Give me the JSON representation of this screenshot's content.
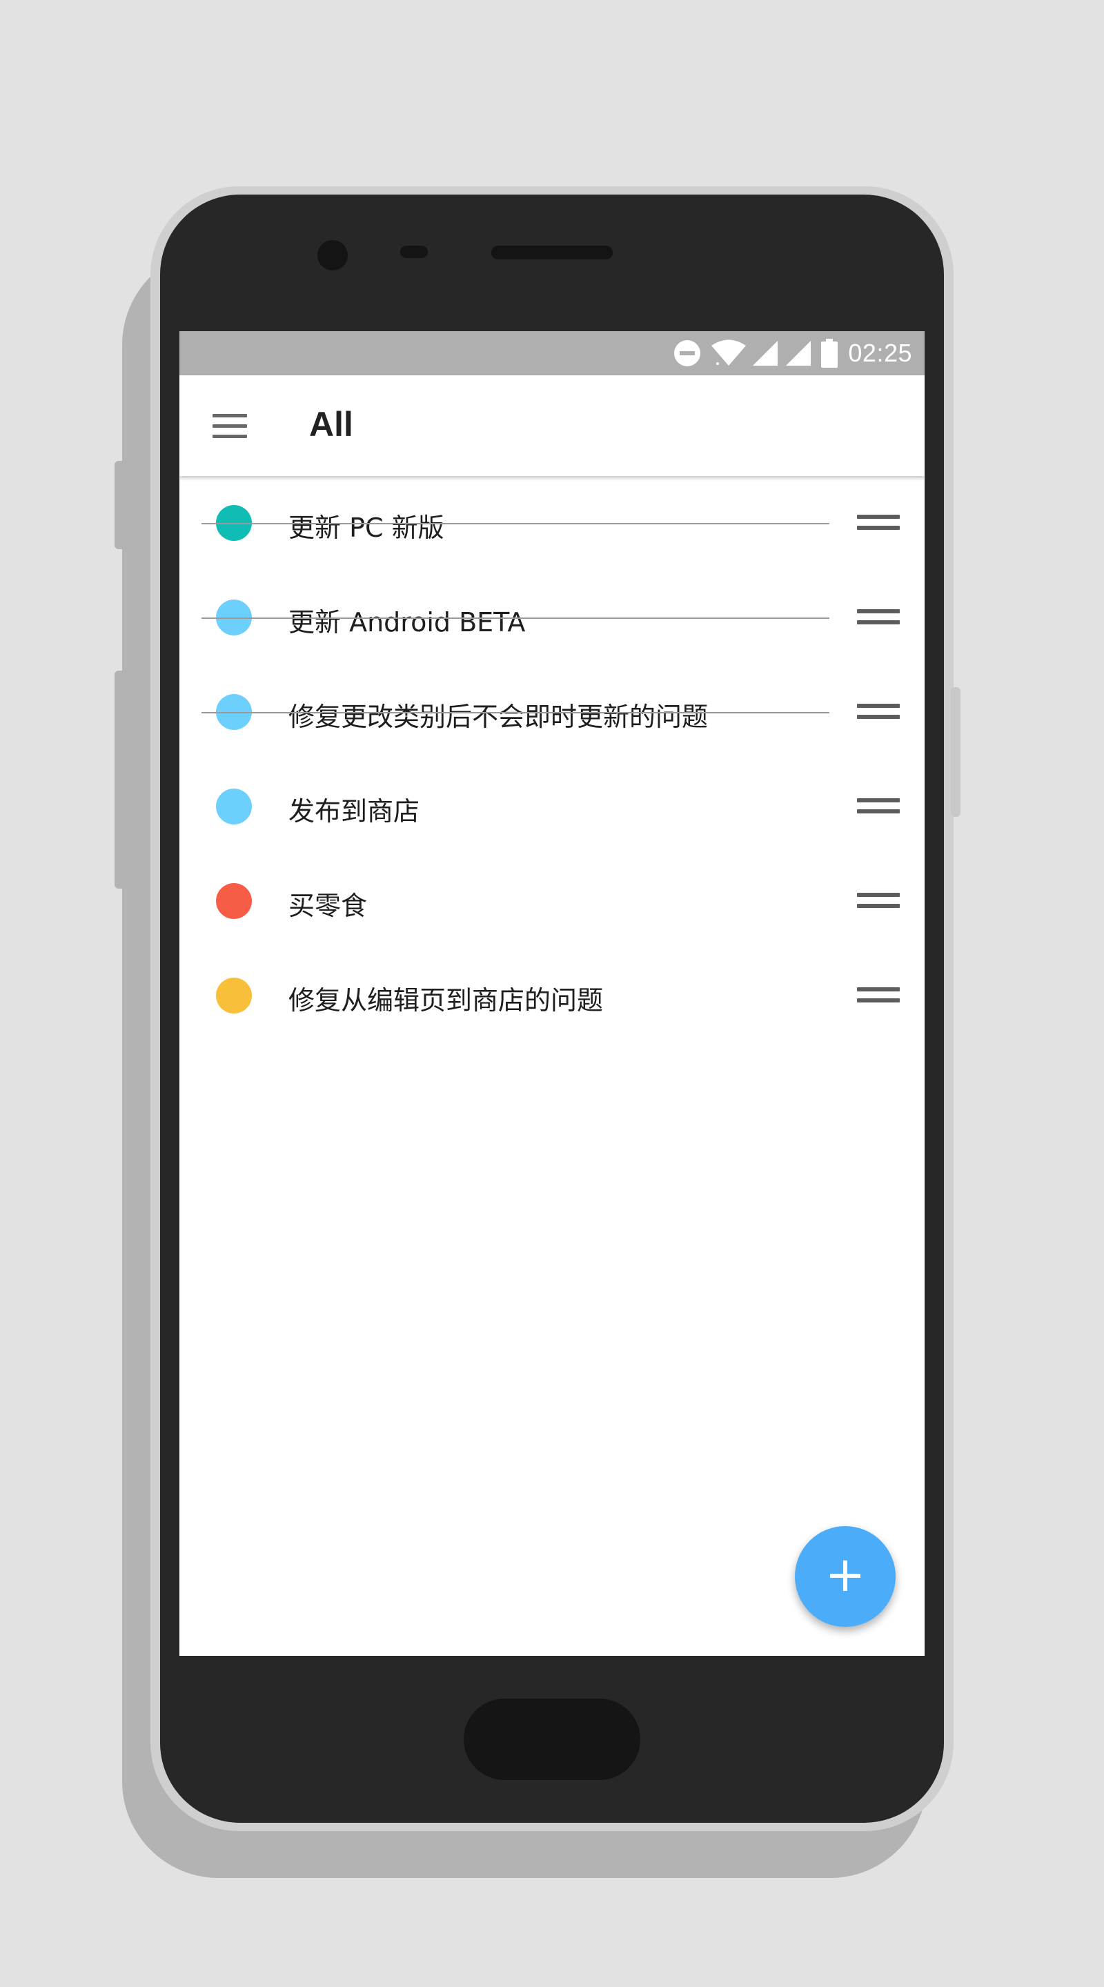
{
  "status_bar": {
    "time": "02:25",
    "icons": [
      "dnd-icon",
      "wifi-icon",
      "signal-icon",
      "signal-icon",
      "battery-icon"
    ]
  },
  "app_bar": {
    "title": "All",
    "menu_icon": "hamburger-menu-icon"
  },
  "tasks": [
    {
      "text": "更新 PC 新版",
      "color": "#0fbdb4",
      "completed": true
    },
    {
      "text": "更新 Android BETA",
      "color": "#6dcffb",
      "completed": true
    },
    {
      "text": "修复更改类别后不会即时更新的问题",
      "color": "#6dcffb",
      "completed": true
    },
    {
      "text": "发布到商店",
      "color": "#6dcffb",
      "completed": false
    },
    {
      "text": "买零食",
      "color": "#f65c46",
      "completed": false
    },
    {
      "text": "修复从编辑页到商店的问题",
      "color": "#f8c03a",
      "completed": false
    }
  ],
  "fab": {
    "icon": "plus-icon",
    "glyph": "+",
    "color": "#4bacf9"
  }
}
